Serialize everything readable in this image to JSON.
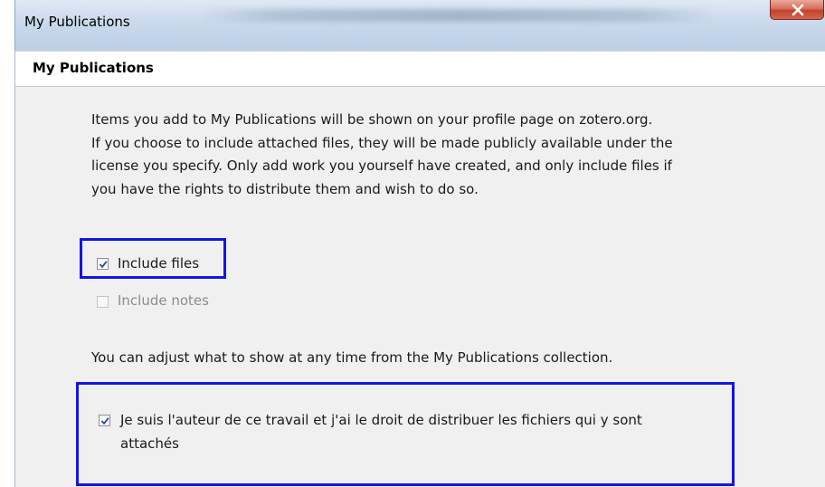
{
  "window": {
    "title": "My Publications",
    "close_icon": "close-icon"
  },
  "header": {
    "title": "My Publications"
  },
  "intro": {
    "lines": [
      "Items you add to My Publications will be shown on your profile page on zotero.org.",
      "If you choose to include attached files, they will be made publicly available under the",
      "license you specify. Only add work you yourself have created, and only include files if",
      "you have the rights to distribute them and wish to do so."
    ]
  },
  "options": {
    "include_files": {
      "label": "Include files",
      "checked": true,
      "enabled": true
    },
    "include_notes": {
      "label": "Include notes",
      "checked": false,
      "enabled": false
    }
  },
  "adjust_note": "You can adjust what to show at any time from the My Publications collection.",
  "rights": {
    "label_line1": "Je suis l'auteur de ce travail et j'ai le droit de distribuer les fichiers qui y sont",
    "label_line2": "attachés",
    "checked": true
  },
  "colors": {
    "highlight": "#1414e6",
    "dialog_bg": "#f0f0f0",
    "checkmark": "#2a47a8"
  }
}
